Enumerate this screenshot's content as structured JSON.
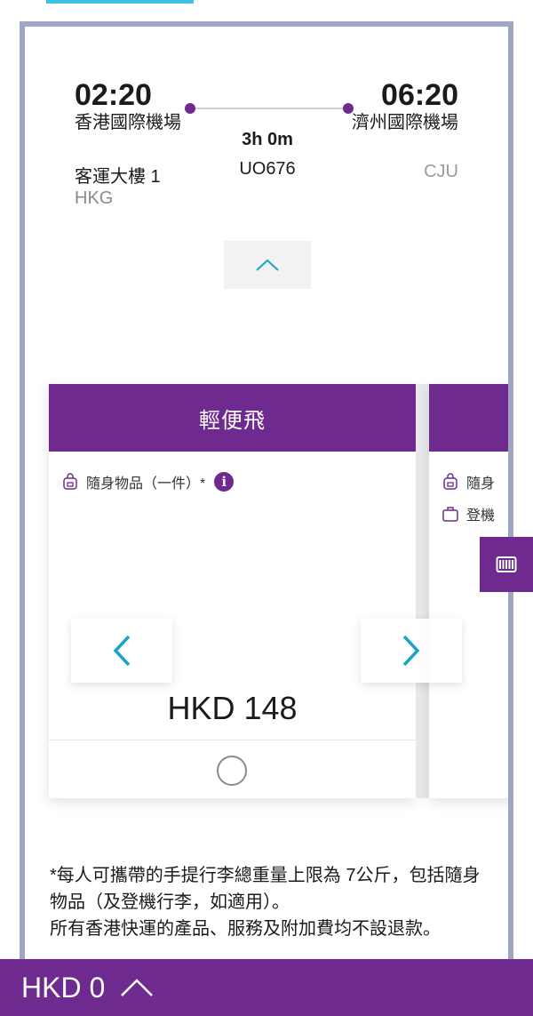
{
  "flight": {
    "departure": {
      "time": "02:20",
      "airport": "香港國際機場",
      "terminal": "客運大樓 1",
      "code": "HKG"
    },
    "arrival": {
      "time": "06:20",
      "airport": "濟州國際機場",
      "code": "CJU"
    },
    "duration": "3h 0m",
    "flight_number": "UO676"
  },
  "fares": [
    {
      "name": "輕便飛",
      "baggage": [
        {
          "icon": "backpack-icon",
          "label": "隨身物品（一件）*"
        }
      ],
      "price": "HKD 148",
      "selected": false
    },
    {
      "name": "",
      "baggage": [
        {
          "icon": "backpack-icon",
          "label": "隨身"
        },
        {
          "icon": "suitcase-icon",
          "label": "登機"
        }
      ]
    }
  ],
  "notes": [
    "*每人可攜帶的手提行李總重量上限為 7公斤，包括隨身物品（及登機行李，如適用）。",
    "所有香港快運的產品、服務及附加費均不設退款。"
  ],
  "summary": {
    "total": "HKD 0"
  },
  "colors": {
    "brand_purple": "#6e2a8e",
    "accent_teal": "#1aa5c8",
    "frame": "#9ea6c2"
  }
}
